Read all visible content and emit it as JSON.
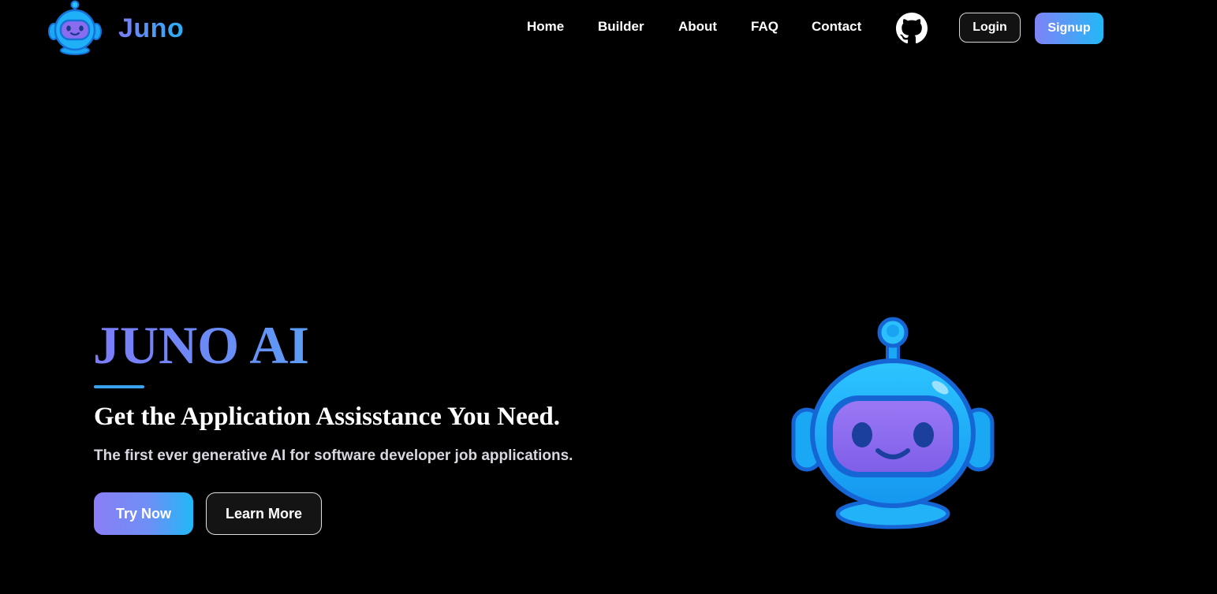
{
  "brand": {
    "name": "Juno",
    "logo_icon": "robot-icon"
  },
  "nav": {
    "links": [
      "Home",
      "Builder",
      "About",
      "FAQ",
      "Contact"
    ],
    "github_icon": "github-icon",
    "login_label": "Login",
    "signup_label": "Signup"
  },
  "hero": {
    "title": "JUNO AI",
    "subtitle": "Get the Application Assisstance You Need.",
    "description": "The first ever generative AI for software developer job applications.",
    "try_label": "Try Now",
    "learn_label": "Learn More",
    "illustration": "robot-mascot-icon"
  },
  "colors": {
    "background": "#000000",
    "accent_purple": "#7c7cf8",
    "accent_blue": "#1fb9f6",
    "robot_blue": "#1aa8f5",
    "robot_face": "#8a6cf0"
  }
}
